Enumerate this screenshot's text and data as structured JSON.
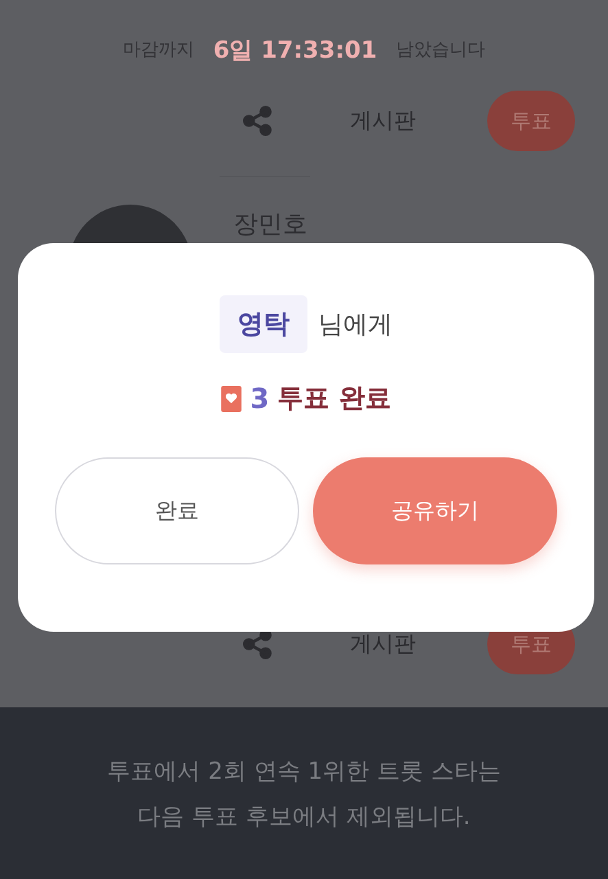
{
  "countdown": {
    "prefix": "마감까지",
    "time": "6일 17:33:01",
    "suffix": "남았습니다"
  },
  "top_actions": {
    "board": "게시판",
    "vote": "투표"
  },
  "candidate": {
    "name": "장민호"
  },
  "bottom_actions": {
    "board": "게시판",
    "vote": "투표"
  },
  "dialog": {
    "recipient": "영탁",
    "recipient_suffix": "님에게",
    "vote_count": "3",
    "vote_text": "투표 완료",
    "buttons": [
      {
        "label": "완료",
        "kind": "secondary"
      },
      {
        "label": "공유하기",
        "kind": "primary"
      }
    ]
  },
  "notice": [
    "투표에서 2회 연속 1위한 트롯 스타는",
    "다음 투표 후보에서 제외됩니다."
  ]
}
